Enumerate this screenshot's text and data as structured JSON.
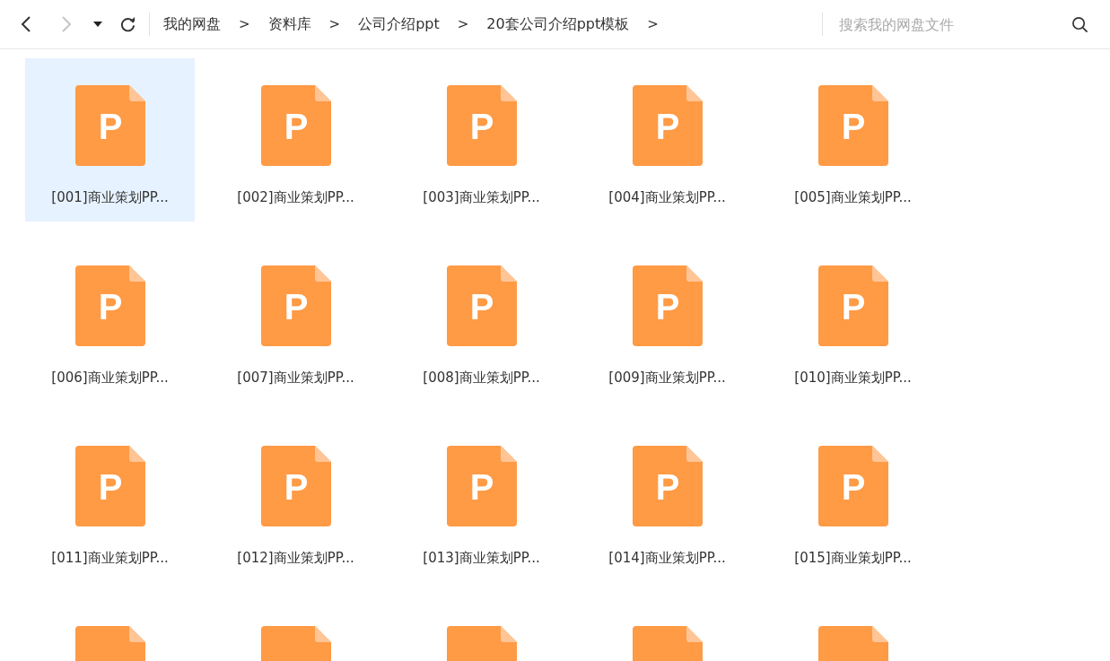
{
  "toolbar": {
    "back_enabled": true,
    "forward_enabled": false
  },
  "breadcrumbs": [
    {
      "label": "我的网盘",
      "separator": ">"
    },
    {
      "label": "资料库",
      "separator": ">"
    },
    {
      "label": "公司介绍ppt",
      "separator": ">"
    },
    {
      "label": "20套公司介绍ppt模板",
      "separator": ">"
    }
  ],
  "search": {
    "placeholder": "搜索我的网盘文件"
  },
  "files": [
    {
      "name": "[001]商业策划PP...",
      "icon_letter": "P",
      "selected": true
    },
    {
      "name": "[002]商业策划PP...",
      "icon_letter": "P",
      "selected": false
    },
    {
      "name": "[003]商业策划PP...",
      "icon_letter": "P",
      "selected": false
    },
    {
      "name": "[004]商业策划PP...",
      "icon_letter": "P",
      "selected": false
    },
    {
      "name": "[005]商业策划PP...",
      "icon_letter": "P",
      "selected": false
    },
    {
      "name": "[006]商业策划PP...",
      "icon_letter": "P",
      "selected": false
    },
    {
      "name": "[007]商业策划PP...",
      "icon_letter": "P",
      "selected": false
    },
    {
      "name": "[008]商业策划PP...",
      "icon_letter": "P",
      "selected": false
    },
    {
      "name": "[009]商业策划PP...",
      "icon_letter": "P",
      "selected": false
    },
    {
      "name": "[010]商业策划PP...",
      "icon_letter": "P",
      "selected": false
    },
    {
      "name": "[011]商业策划PP...",
      "icon_letter": "P",
      "selected": false
    },
    {
      "name": "[012]商业策划PP...",
      "icon_letter": "P",
      "selected": false
    },
    {
      "name": "[013]商业策划PP...",
      "icon_letter": "P",
      "selected": false
    },
    {
      "name": "[014]商业策划PP...",
      "icon_letter": "P",
      "selected": false
    },
    {
      "name": "[015]商业策划PP...",
      "icon_letter": "P",
      "selected": false
    },
    {
      "selected": false
    },
    {
      "selected": false
    },
    {
      "selected": false
    },
    {
      "selected": false
    },
    {
      "selected": false
    }
  ]
}
